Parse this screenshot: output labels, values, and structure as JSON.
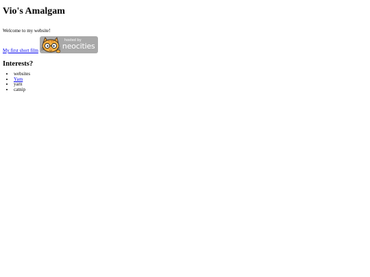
{
  "page": {
    "title": "Vio's Amalgam",
    "welcome": "Welcome to my website!",
    "film_link": "My first short film",
    "badge": {
      "hosted_text": "hosted by",
      "name": "neocities",
      "color": "#a9a9a9"
    }
  },
  "interests": {
    "heading": "Interests?",
    "items": [
      "websites",
      "Yarn",
      "yarn",
      "catnip"
    ]
  },
  "colors": {
    "link": "#0000ee",
    "text": "#000000",
    "background": "#ffffff"
  }
}
